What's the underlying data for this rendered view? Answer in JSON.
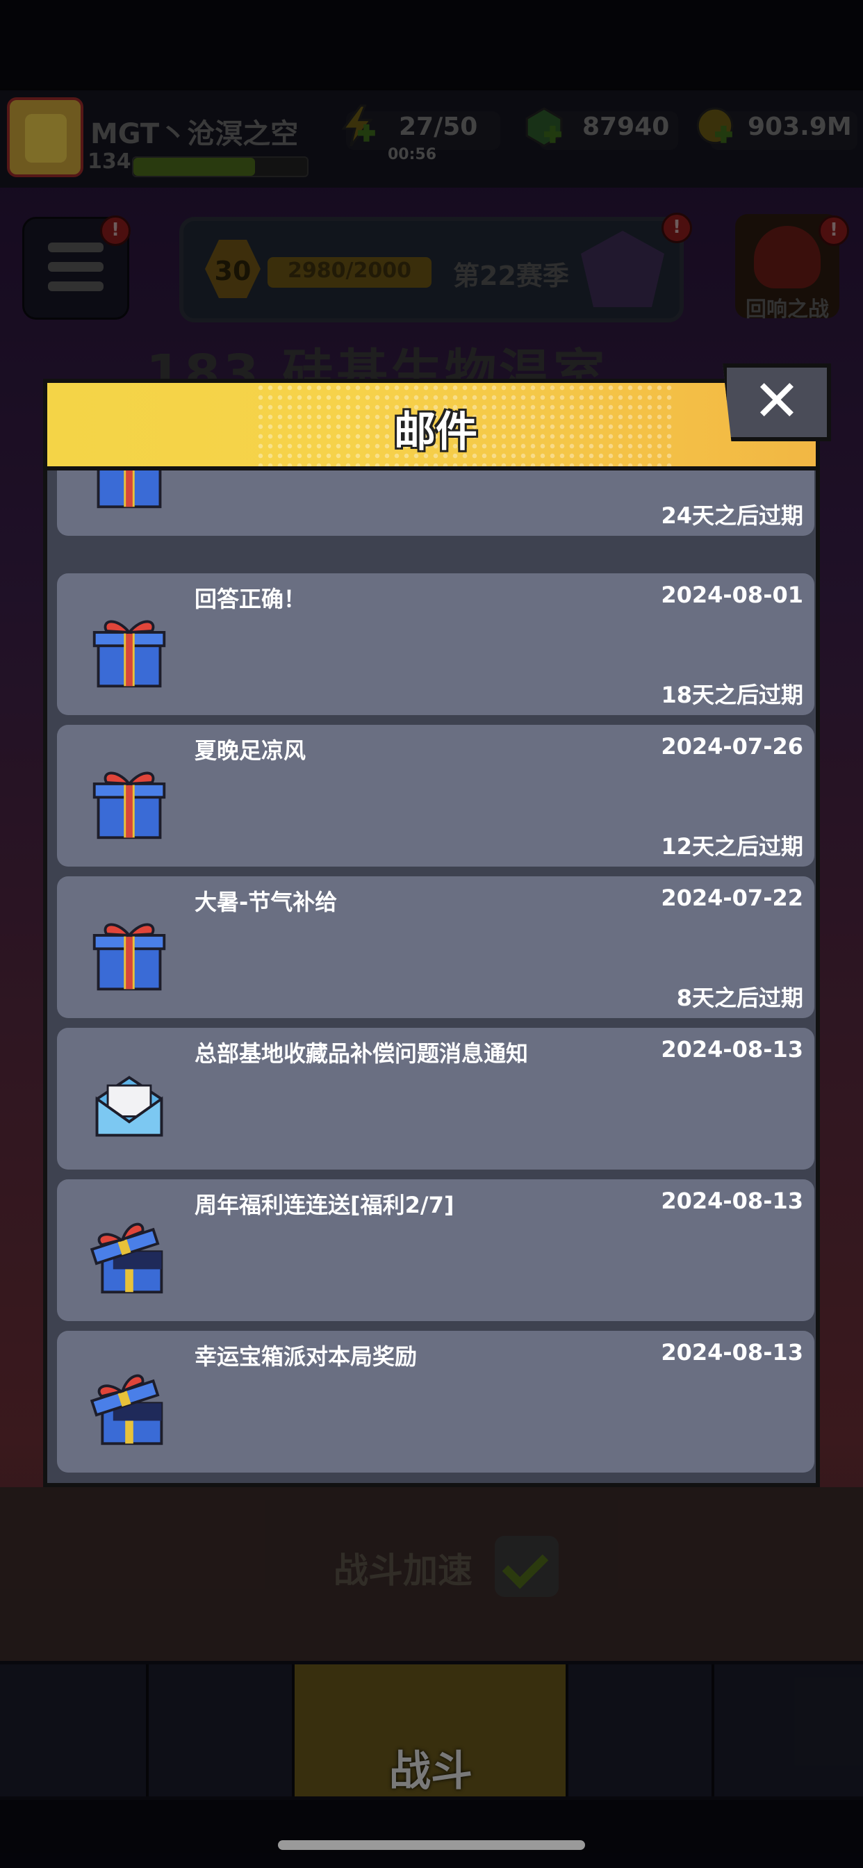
{
  "hud": {
    "player_name": "MGT丶沧溟之空",
    "player_level": "134",
    "xp_fraction": 0.7,
    "energy": "27/50",
    "energy_timer": "00:56",
    "gems": "87940",
    "coins": "903.9M"
  },
  "season": {
    "level": "30",
    "progress": "2980/2000",
    "name": "第22赛季"
  },
  "echo_battle": {
    "label": "回响之战"
  },
  "menu_badge": "!",
  "level_title": "183 硅基生物温室",
  "modal": {
    "title": "邮件",
    "close_label": "✕"
  },
  "mails": [
    {
      "title": "",
      "date": "",
      "expire": "24天之后过期",
      "icon": "gift-closed-icon"
    },
    {
      "title": "回答正确！",
      "date": "2024-08-01",
      "expire": "18天之后过期",
      "icon": "gift-closed-icon"
    },
    {
      "title": "夏晚足凉风",
      "date": "2024-07-26",
      "expire": "12天之后过期",
      "icon": "gift-closed-icon"
    },
    {
      "title": "大暑-节气补给",
      "date": "2024-07-22",
      "expire": "8天之后过期",
      "icon": "gift-closed-icon"
    },
    {
      "title": "总部基地收藏品补偿问题消息通知",
      "date": "2024-08-13",
      "expire": "",
      "icon": "envelope-open-icon"
    },
    {
      "title": "周年福利连连送[福利2/7]",
      "date": "2024-08-13",
      "expire": "",
      "icon": "gift-open-icon"
    },
    {
      "title": "幸运宝箱派对本局奖励",
      "date": "2024-08-13",
      "expire": "",
      "icon": "gift-open-icon"
    }
  ],
  "bottom": {
    "speed_label": "战斗加速",
    "battle_tab": "战斗"
  },
  "colors": {
    "header_yellow": "#f4d447",
    "mail_item_bg": "#6a6f82",
    "modal_bg": "#3e4250"
  }
}
